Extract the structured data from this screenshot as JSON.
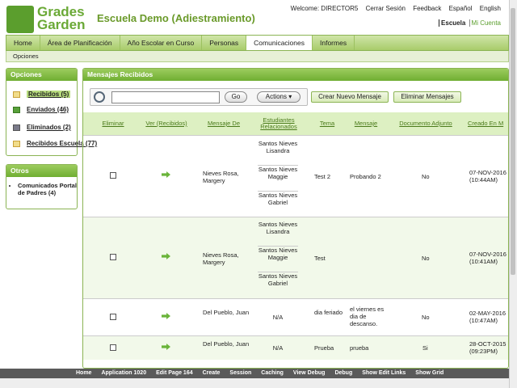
{
  "header": {
    "logo_line1": "Grades",
    "logo_line2": "Garden",
    "title": "Escuela Demo (Adiestramiento)",
    "welcome": "Welcome: DIRECTOR5",
    "links": [
      "Cerrar Sesión",
      "Feedback",
      "Español",
      "English"
    ],
    "scope_current": "Escuela",
    "scope_alt": "Mi Cuenta"
  },
  "nav": {
    "tabs": [
      "Home",
      "Área de Planificación",
      "Año Escolar en Curso",
      "Personas",
      "Comunicaciones",
      "Informes"
    ],
    "active": "Comunicaciones",
    "sub": "Opciones"
  },
  "options": {
    "title": "Opciones",
    "items": [
      {
        "label": "Recibidos (5)",
        "icon": "folder-icon"
      },
      {
        "label": "Enviados (46)",
        "icon": "send-icon"
      },
      {
        "label": "Eliminados (2)",
        "icon": "trash-icon"
      },
      {
        "label": "Recibidos Escuela (77)",
        "icon": "folder-icon"
      }
    ]
  },
  "otros": {
    "title": "Otros",
    "items": [
      "Comunicados Portal de Padres (4)"
    ]
  },
  "main": {
    "title": "Mensajes Recibidos",
    "search_value": "",
    "go_label": "Go",
    "actions_label": "Actions",
    "new_label": "Crear Nuevo Mensaje",
    "delete_label": "Eliminar Mensajes",
    "columns": [
      "Eliminar",
      "Ver (Recibidos)",
      "Mensaje De",
      "Estudiantes Relacionados",
      "Tema",
      "Mensaje",
      "Documento Adjunto",
      "Creado En M"
    ]
  },
  "rows": [
    {
      "from": "Nieves Rosa, Margery",
      "students": [
        "Santos Nieves Lisandra",
        "Santos Nieves Maggie",
        "Santos Nieves Gabriel"
      ],
      "subject": "Test 2",
      "message": "Probando 2",
      "attach": "No",
      "created": "07-NOV-2016 (10:44AM)"
    },
    {
      "from": "Nieves Rosa, Margery",
      "students": [
        "Santos Nieves Lisandra",
        "Santos Nieves Maggie",
        "Santos Nieves Gabriel"
      ],
      "subject": "Test",
      "message": "",
      "attach": "No",
      "created": "07-NOV-2016 (10:41AM)"
    },
    {
      "from": "Del Pueblo, Juan",
      "students": [
        "N/A"
      ],
      "subject": "dia feriado",
      "message": "el viernes es dia de descanso.",
      "attach": "No",
      "created": "02-MAY-2016 (10:47AM)"
    },
    {
      "from": "Del Pueblo, Juan",
      "students": [
        "N/A"
      ],
      "subject": "Prueba",
      "message": "prueba",
      "attach": "Si",
      "created": "28-OCT-2015 (09:23PM)"
    }
  ],
  "devbar": [
    "Home",
    "Application 1020",
    "Edit Page 164",
    "Create",
    "Session",
    "Caching",
    "View Debug",
    "Debug",
    "Show Edit Links",
    "Show Grid"
  ]
}
